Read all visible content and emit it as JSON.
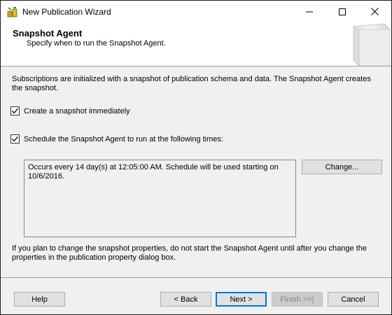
{
  "window": {
    "title": "New Publication Wizard",
    "controls": {
      "minimize_icon": "minimize-icon",
      "maximize_icon": "maximize-icon",
      "close_icon": "close-icon"
    }
  },
  "header": {
    "title": "Snapshot Agent",
    "subtitle": "Specify when to run the Snapshot Agent."
  },
  "body": {
    "intro": "Subscriptions are initialized with a snapshot of publication schema and data. The Snapshot Agent creates the snapshot.",
    "create_snapshot": {
      "label": "Create a snapshot immediately",
      "checked": true
    },
    "schedule_agent": {
      "label": "Schedule the Snapshot Agent to run at the following times:",
      "checked": true
    },
    "schedule_text": "Occurs every 14 day(s) at 12:05:00 AM. Schedule will be used starting on 10/6/2016.",
    "change_label": "Change...",
    "footnote": "If you plan to change the snapshot properties, do not start the Snapshot Agent until after you change the properties in the publication property dialog box."
  },
  "footer": {
    "help": "Help",
    "back": "< Back",
    "next": "Next >",
    "finish": "Finish >>|",
    "cancel": "Cancel"
  },
  "colors": {
    "accent": "#0078d7",
    "window_bg": "#f0f0f0",
    "button_bg": "#e1e1e1"
  }
}
